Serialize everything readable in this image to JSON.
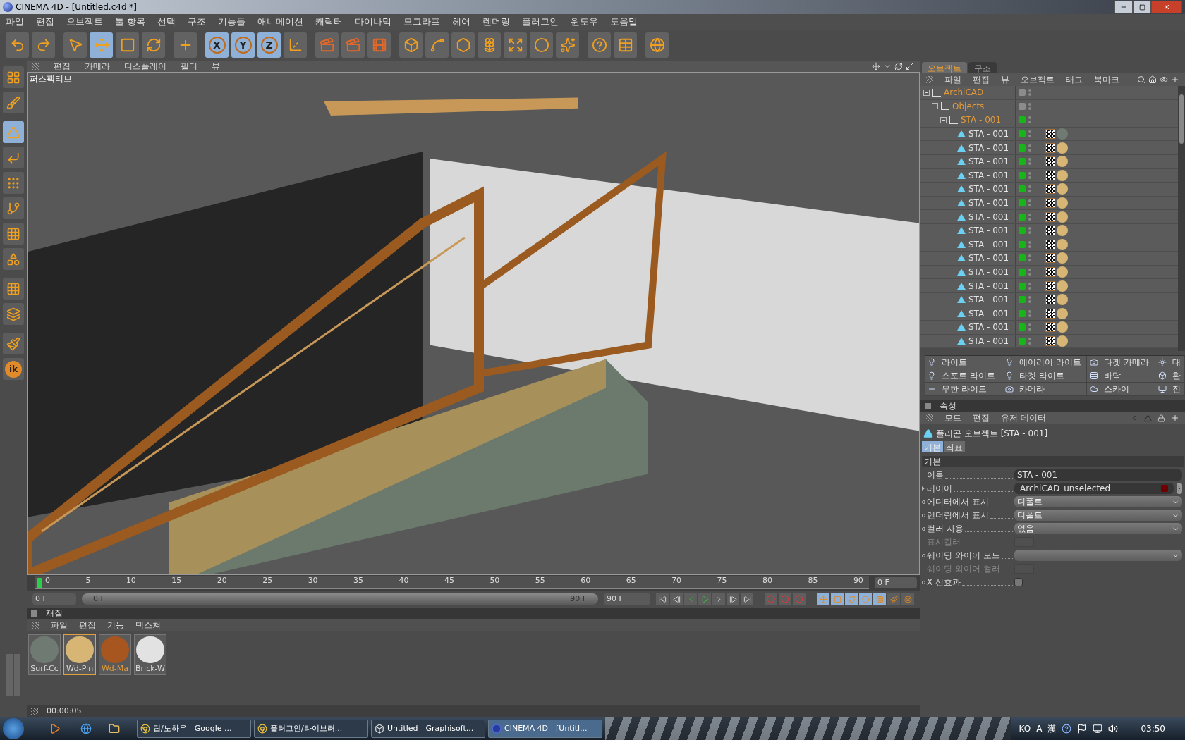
{
  "window": {
    "title": "CINEMA 4D - [Untitled.c4d *]"
  },
  "menu": [
    "파일",
    "편집",
    "오브젝트",
    "툴 항목",
    "선택",
    "구조",
    "기능들",
    "애니메이션",
    "캐릭터",
    "다이나믹",
    "모그라프",
    "헤어",
    "렌더링",
    "플러그인",
    "윈도우",
    "도움말"
  ],
  "toolbar": [
    {
      "kind": "undo",
      "selected": false
    },
    {
      "kind": "redo",
      "selected": false
    },
    {
      "kind": "select",
      "selected": false
    },
    {
      "kind": "move",
      "selected": true
    },
    {
      "kind": "scale",
      "selected": false
    },
    {
      "kind": "rotate",
      "selected": false
    },
    {
      "kind": "add",
      "selected": false
    },
    {
      "kind": "axis",
      "label": "X",
      "selected": true
    },
    {
      "kind": "axis",
      "label": "Y",
      "selected": true
    },
    {
      "kind": "axis",
      "label": "Z",
      "selected": true
    },
    {
      "kind": "coords",
      "selected": false
    },
    {
      "kind": "render-view",
      "selected": false
    },
    {
      "kind": "render-picture",
      "selected": false
    },
    {
      "kind": "render-settings",
      "selected": false
    },
    {
      "kind": "cube",
      "selected": false
    },
    {
      "kind": "spline",
      "selected": false
    },
    {
      "kind": "nurbs",
      "selected": false
    },
    {
      "kind": "array",
      "selected": false
    },
    {
      "kind": "deformer",
      "selected": false
    },
    {
      "kind": "scene",
      "selected": false
    },
    {
      "kind": "particles",
      "selected": false
    },
    {
      "kind": "help",
      "selected": false
    },
    {
      "kind": "table",
      "selected": false
    },
    {
      "kind": "globe",
      "selected": false
    }
  ],
  "left_toolbar": [
    {
      "kind": "layout",
      "selected": false
    },
    {
      "kind": "sculpt",
      "selected": false
    },
    {
      "kind": "model",
      "selected": true
    },
    {
      "kind": "axis",
      "selected": false
    },
    {
      "kind": "points",
      "selected": false
    },
    {
      "kind": "edges",
      "selected": false
    },
    {
      "kind": "polygons",
      "selected": false
    },
    {
      "kind": "uvw",
      "selected": false
    },
    {
      "kind": "texture",
      "selected": false
    },
    {
      "kind": "texture-axis",
      "selected": false
    },
    {
      "kind": "paint",
      "selected": false
    },
    {
      "kind": "ik",
      "label": "ik",
      "selected": false
    }
  ],
  "viewport": {
    "menu": [
      "편집",
      "카메라",
      "디스플레이",
      "필터",
      "뷰"
    ],
    "label": "퍼스펙티브"
  },
  "timeline": {
    "ticks": [
      "0",
      "5",
      "10",
      "15",
      "20",
      "25",
      "30",
      "35",
      "40",
      "45",
      "50",
      "55",
      "60",
      "65",
      "70",
      "75",
      "80",
      "85",
      "90"
    ],
    "current": "0 F",
    "start": "0 F",
    "range_start": "0 F",
    "range_end": "90 F",
    "end": "90 F"
  },
  "materials": {
    "title": "재질",
    "menu": [
      "파일",
      "편집",
      "기능",
      "텍스쳐"
    ],
    "items": [
      {
        "name": "Surf-Cc",
        "color": "#6f7a72",
        "selected": false,
        "active": false
      },
      {
        "name": "Wd-Pin",
        "color": "#d7b574",
        "selected": true,
        "active": false
      },
      {
        "name": "Wd-Ma",
        "color": "#a8561f",
        "selected": false,
        "active": true
      },
      {
        "name": "Brick-W",
        "color": "#e2e2e2",
        "selected": false,
        "active": false
      }
    ]
  },
  "status_bar": {
    "time": "00:00:05"
  },
  "object_manager": {
    "tabs": [
      {
        "label": "오브젝트",
        "selected": true
      },
      {
        "label": "구조",
        "selected": false
      }
    ],
    "menu": [
      "파일",
      "편집",
      "뷰",
      "오브젝트",
      "태그",
      "북마크"
    ],
    "tree": [
      {
        "name": "ArchiCAD",
        "kind": "null",
        "selected": true,
        "expanded": true,
        "color": "#8c8c8c",
        "children": [
          {
            "name": "Objects",
            "kind": "null",
            "selected": true,
            "expanded": true,
            "color": "#8c8c8c",
            "children": [
              {
                "name": "STA - 001",
                "kind": "null",
                "selected": true,
                "expanded": true,
                "color": "#19b419",
                "children": [
                  {
                    "name": "STA - 001",
                    "kind": "polygon",
                    "selected": false,
                    "color": "#19b419",
                    "material": {
                      "color": "#6f7a72"
                    }
                  },
                  {
                    "name": "STA - 001",
                    "kind": "polygon",
                    "selected": false,
                    "color": "#19b419",
                    "material": {
                      "color": "#d7b574"
                    }
                  },
                  {
                    "name": "STA - 001",
                    "kind": "polygon",
                    "selected": false,
                    "color": "#19b419",
                    "material": {
                      "color": "#d7b574"
                    }
                  },
                  {
                    "name": "STA - 001",
                    "kind": "polygon",
                    "selected": false,
                    "color": "#19b419",
                    "material": {
                      "color": "#d7b574"
                    }
                  },
                  {
                    "name": "STA - 001",
                    "kind": "polygon",
                    "selected": false,
                    "color": "#19b419",
                    "material": {
                      "color": "#d7b574"
                    }
                  },
                  {
                    "name": "STA - 001",
                    "kind": "polygon",
                    "selected": false,
                    "color": "#19b419",
                    "material": {
                      "color": "#d7b574"
                    }
                  },
                  {
                    "name": "STA - 001",
                    "kind": "polygon",
                    "selected": false,
                    "color": "#19b419",
                    "material": {
                      "color": "#d7b574"
                    }
                  },
                  {
                    "name": "STA - 001",
                    "kind": "polygon",
                    "selected": false,
                    "color": "#19b419",
                    "material": {
                      "color": "#d7b574"
                    }
                  },
                  {
                    "name": "STA - 001",
                    "kind": "polygon",
                    "selected": false,
                    "color": "#19b419",
                    "material": {
                      "color": "#d7b574"
                    }
                  },
                  {
                    "name": "STA - 001",
                    "kind": "polygon",
                    "selected": false,
                    "color": "#19b419",
                    "material": {
                      "color": "#d7b574"
                    }
                  },
                  {
                    "name": "STA - 001",
                    "kind": "polygon",
                    "selected": false,
                    "color": "#19b419",
                    "material": {
                      "color": "#d7b574"
                    }
                  },
                  {
                    "name": "STA - 001",
                    "kind": "polygon",
                    "selected": false,
                    "color": "#19b419",
                    "material": {
                      "color": "#d7b574"
                    }
                  },
                  {
                    "name": "STA - 001",
                    "kind": "polygon",
                    "selected": false,
                    "color": "#19b419",
                    "material": {
                      "color": "#d7b574"
                    }
                  },
                  {
                    "name": "STA - 001",
                    "kind": "polygon",
                    "selected": false,
                    "color": "#19b419",
                    "material": {
                      "color": "#d7b574"
                    }
                  },
                  {
                    "name": "STA - 001",
                    "kind": "polygon",
                    "selected": false,
                    "color": "#19b419",
                    "material": {
                      "color": "#d7b574"
                    }
                  },
                  {
                    "name": "STA - 001",
                    "kind": "polygon",
                    "selected": false,
                    "color": "#19b419",
                    "material": {
                      "color": "#d7b574"
                    }
                  }
                ]
              }
            ]
          }
        ]
      }
    ]
  },
  "light_palette": [
    {
      "label": "라이트",
      "kind": "light"
    },
    {
      "label": "에어리어 라이트",
      "kind": "area"
    },
    {
      "label": "타겟 카메라",
      "kind": "camera"
    },
    {
      "label": "태",
      "kind": "sun"
    },
    {
      "label": "스포트 라이트",
      "kind": "spot"
    },
    {
      "label": "타겟 라이트",
      "kind": "spot"
    },
    {
      "label": "바닥",
      "kind": "floor"
    },
    {
      "label": "환",
      "kind": "env"
    },
    {
      "label": "무한 라이트",
      "kind": "infinite"
    },
    {
      "label": "카메라",
      "kind": "camera"
    },
    {
      "label": "스카이",
      "kind": "sky"
    },
    {
      "label": "전",
      "kind": "stage"
    }
  ],
  "attributes": {
    "title": "속성",
    "menu": [
      "모드",
      "편집",
      "유저 데이터"
    ],
    "object_title": "폴리곤 오브젝트 [STA - 001]",
    "tabs": [
      {
        "label": "기본",
        "selected": true
      },
      {
        "label": "좌표",
        "selected": false
      }
    ],
    "section": "기본",
    "fields": [
      {
        "label": "이름",
        "kind": "text",
        "value": "STA - 001",
        "disabled": false
      },
      {
        "label": "레이어",
        "kind": "layer",
        "value": "ArchiCAD_unselected",
        "marker": {
          "kind": "arrow"
        },
        "disabled": false,
        "color": "#6e0000"
      },
      {
        "label": "에디터에서 표시",
        "kind": "dropdown",
        "value": "디폴트",
        "marker": {
          "kind": "circle"
        },
        "disabled": false
      },
      {
        "label": "렌더링에서 표시",
        "kind": "dropdown",
        "value": "디폴트",
        "marker": {
          "kind": "circle"
        },
        "disabled": false
      },
      {
        "label": "컬러 사용",
        "kind": "dropdown",
        "value": "없음",
        "marker": {
          "kind": "circle"
        },
        "disabled": false
      },
      {
        "label": "표시컬러",
        "kind": "color",
        "disabled": true
      },
      {
        "label": "쉐이딩 와이어 모드",
        "kind": "dropdown",
        "marker": {
          "kind": "circle"
        },
        "disabled": false
      },
      {
        "label": "쉐이딩 와이어 컬러",
        "kind": "color",
        "disabled": true
      },
      {
        "label": "X 선효과",
        "kind": "checkbox",
        "checked": false,
        "marker": {
          "kind": "circle"
        },
        "disabled": false
      }
    ]
  },
  "taskbar": {
    "tasks": [
      {
        "label": "팁/노하우 - Google ...",
        "kind": "browser",
        "selected": false
      },
      {
        "label": "플러그인/라이브러...",
        "kind": "browser",
        "selected": false
      },
      {
        "label": "Untitled - Graphisoft...",
        "kind": "archicad",
        "selected": false
      },
      {
        "label": "CINEMA 4D - [Untitl...",
        "kind": "c4d",
        "selected": true
      }
    ],
    "tray": [
      "KO",
      "A",
      "漢"
    ],
    "clock": "03:50"
  }
}
